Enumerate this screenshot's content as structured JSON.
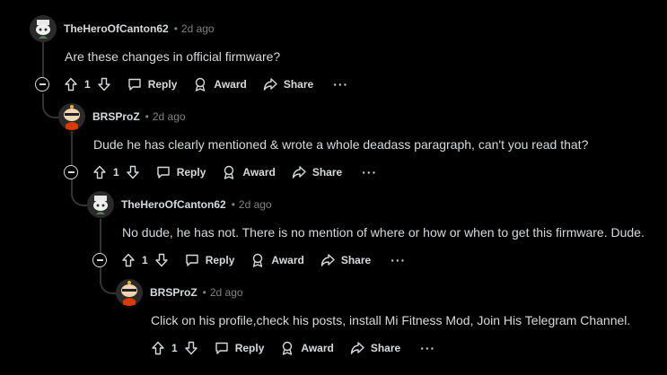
{
  "actions": {
    "reply_label": "Reply",
    "award_label": "Award",
    "share_label": "Share",
    "more_label": "···"
  },
  "comments": [
    {
      "username": "TheHeroOfCanton62",
      "separator": "•",
      "time": "2d ago",
      "text": "Are these changes in official firmware?",
      "votes": "1"
    },
    {
      "username": "BRSProZ",
      "separator": "•",
      "time": "2d ago",
      "text": "Dude he has clearly mentioned & wrote a whole deadass paragraph, can't you read that?",
      "votes": "1"
    },
    {
      "username": "TheHeroOfCanton62",
      "separator": "•",
      "time": "2d ago",
      "text": "No dude, he has not. There is no mention of where or how or when to get this firmware. Dude.",
      "votes": "1"
    },
    {
      "username": "BRSProZ",
      "separator": "•",
      "time": "2d ago",
      "text": "Click on his profile,check his posts, install Mi Fitness Mod, Join His Telegram Channel.",
      "votes": "1"
    }
  ],
  "colors": {
    "background": "#000000",
    "text": "#d7dadc",
    "muted": "#818384",
    "thread": "#343536"
  }
}
